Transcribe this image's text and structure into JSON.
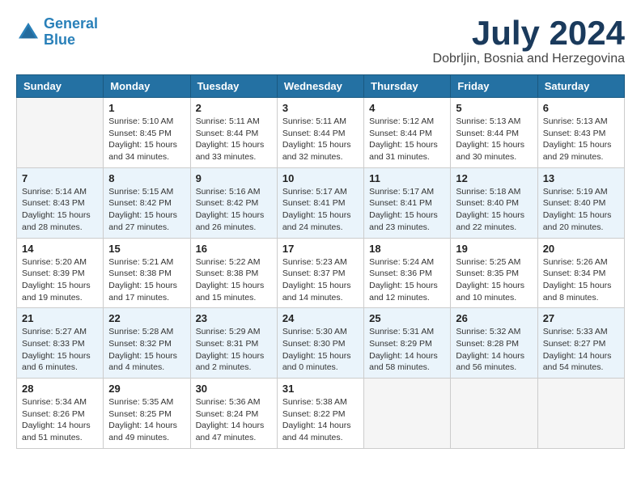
{
  "logo": {
    "line1": "General",
    "line2": "Blue"
  },
  "title": "July 2024",
  "location": "Dobrljin, Bosnia and Herzegovina",
  "weekdays": [
    "Sunday",
    "Monday",
    "Tuesday",
    "Wednesday",
    "Thursday",
    "Friday",
    "Saturday"
  ],
  "days": [
    {
      "num": "",
      "sunrise": "",
      "sunset": "",
      "daylight": ""
    },
    {
      "num": "1",
      "sunrise": "Sunrise: 5:10 AM",
      "sunset": "Sunset: 8:45 PM",
      "daylight": "Daylight: 15 hours and 34 minutes."
    },
    {
      "num": "2",
      "sunrise": "Sunrise: 5:11 AM",
      "sunset": "Sunset: 8:44 PM",
      "daylight": "Daylight: 15 hours and 33 minutes."
    },
    {
      "num": "3",
      "sunrise": "Sunrise: 5:11 AM",
      "sunset": "Sunset: 8:44 PM",
      "daylight": "Daylight: 15 hours and 32 minutes."
    },
    {
      "num": "4",
      "sunrise": "Sunrise: 5:12 AM",
      "sunset": "Sunset: 8:44 PM",
      "daylight": "Daylight: 15 hours and 31 minutes."
    },
    {
      "num": "5",
      "sunrise": "Sunrise: 5:13 AM",
      "sunset": "Sunset: 8:44 PM",
      "daylight": "Daylight: 15 hours and 30 minutes."
    },
    {
      "num": "6",
      "sunrise": "Sunrise: 5:13 AM",
      "sunset": "Sunset: 8:43 PM",
      "daylight": "Daylight: 15 hours and 29 minutes."
    },
    {
      "num": "7",
      "sunrise": "Sunrise: 5:14 AM",
      "sunset": "Sunset: 8:43 PM",
      "daylight": "Daylight: 15 hours and 28 minutes."
    },
    {
      "num": "8",
      "sunrise": "Sunrise: 5:15 AM",
      "sunset": "Sunset: 8:42 PM",
      "daylight": "Daylight: 15 hours and 27 minutes."
    },
    {
      "num": "9",
      "sunrise": "Sunrise: 5:16 AM",
      "sunset": "Sunset: 8:42 PM",
      "daylight": "Daylight: 15 hours and 26 minutes."
    },
    {
      "num": "10",
      "sunrise": "Sunrise: 5:17 AM",
      "sunset": "Sunset: 8:41 PM",
      "daylight": "Daylight: 15 hours and 24 minutes."
    },
    {
      "num": "11",
      "sunrise": "Sunrise: 5:17 AM",
      "sunset": "Sunset: 8:41 PM",
      "daylight": "Daylight: 15 hours and 23 minutes."
    },
    {
      "num": "12",
      "sunrise": "Sunrise: 5:18 AM",
      "sunset": "Sunset: 8:40 PM",
      "daylight": "Daylight: 15 hours and 22 minutes."
    },
    {
      "num": "13",
      "sunrise": "Sunrise: 5:19 AM",
      "sunset": "Sunset: 8:40 PM",
      "daylight": "Daylight: 15 hours and 20 minutes."
    },
    {
      "num": "14",
      "sunrise": "Sunrise: 5:20 AM",
      "sunset": "Sunset: 8:39 PM",
      "daylight": "Daylight: 15 hours and 19 minutes."
    },
    {
      "num": "15",
      "sunrise": "Sunrise: 5:21 AM",
      "sunset": "Sunset: 8:38 PM",
      "daylight": "Daylight: 15 hours and 17 minutes."
    },
    {
      "num": "16",
      "sunrise": "Sunrise: 5:22 AM",
      "sunset": "Sunset: 8:38 PM",
      "daylight": "Daylight: 15 hours and 15 minutes."
    },
    {
      "num": "17",
      "sunrise": "Sunrise: 5:23 AM",
      "sunset": "Sunset: 8:37 PM",
      "daylight": "Daylight: 15 hours and 14 minutes."
    },
    {
      "num": "18",
      "sunrise": "Sunrise: 5:24 AM",
      "sunset": "Sunset: 8:36 PM",
      "daylight": "Daylight: 15 hours and 12 minutes."
    },
    {
      "num": "19",
      "sunrise": "Sunrise: 5:25 AM",
      "sunset": "Sunset: 8:35 PM",
      "daylight": "Daylight: 15 hours and 10 minutes."
    },
    {
      "num": "20",
      "sunrise": "Sunrise: 5:26 AM",
      "sunset": "Sunset: 8:34 PM",
      "daylight": "Daylight: 15 hours and 8 minutes."
    },
    {
      "num": "21",
      "sunrise": "Sunrise: 5:27 AM",
      "sunset": "Sunset: 8:33 PM",
      "daylight": "Daylight: 15 hours and 6 minutes."
    },
    {
      "num": "22",
      "sunrise": "Sunrise: 5:28 AM",
      "sunset": "Sunset: 8:32 PM",
      "daylight": "Daylight: 15 hours and 4 minutes."
    },
    {
      "num": "23",
      "sunrise": "Sunrise: 5:29 AM",
      "sunset": "Sunset: 8:31 PM",
      "daylight": "Daylight: 15 hours and 2 minutes."
    },
    {
      "num": "24",
      "sunrise": "Sunrise: 5:30 AM",
      "sunset": "Sunset: 8:30 PM",
      "daylight": "Daylight: 15 hours and 0 minutes."
    },
    {
      "num": "25",
      "sunrise": "Sunrise: 5:31 AM",
      "sunset": "Sunset: 8:29 PM",
      "daylight": "Daylight: 14 hours and 58 minutes."
    },
    {
      "num": "26",
      "sunrise": "Sunrise: 5:32 AM",
      "sunset": "Sunset: 8:28 PM",
      "daylight": "Daylight: 14 hours and 56 minutes."
    },
    {
      "num": "27",
      "sunrise": "Sunrise: 5:33 AM",
      "sunset": "Sunset: 8:27 PM",
      "daylight": "Daylight: 14 hours and 54 minutes."
    },
    {
      "num": "28",
      "sunrise": "Sunrise: 5:34 AM",
      "sunset": "Sunset: 8:26 PM",
      "daylight": "Daylight: 14 hours and 51 minutes."
    },
    {
      "num": "29",
      "sunrise": "Sunrise: 5:35 AM",
      "sunset": "Sunset: 8:25 PM",
      "daylight": "Daylight: 14 hours and 49 minutes."
    },
    {
      "num": "30",
      "sunrise": "Sunrise: 5:36 AM",
      "sunset": "Sunset: 8:24 PM",
      "daylight": "Daylight: 14 hours and 47 minutes."
    },
    {
      "num": "31",
      "sunrise": "Sunrise: 5:38 AM",
      "sunset": "Sunset: 8:22 PM",
      "daylight": "Daylight: 14 hours and 44 minutes."
    },
    {
      "num": "",
      "sunrise": "",
      "sunset": "",
      "daylight": ""
    },
    {
      "num": "",
      "sunrise": "",
      "sunset": "",
      "daylight": ""
    },
    {
      "num": "",
      "sunrise": "",
      "sunset": "",
      "daylight": ""
    },
    {
      "num": "",
      "sunrise": "",
      "sunset": "",
      "daylight": ""
    },
    {
      "num": "",
      "sunrise": "",
      "sunset": "",
      "daylight": ""
    }
  ]
}
